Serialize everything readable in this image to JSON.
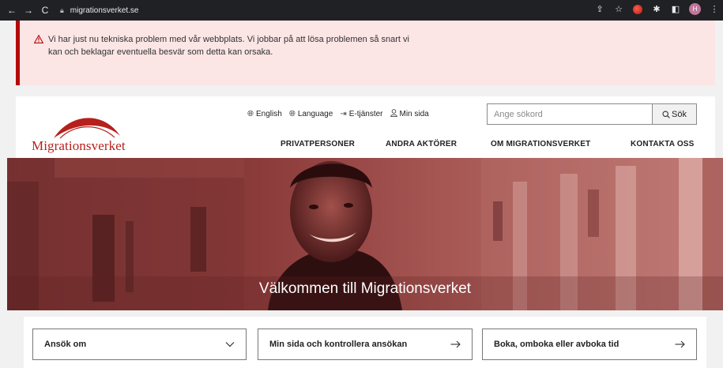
{
  "browser": {
    "url": "migrationsverket.se",
    "profile_initial": "H"
  },
  "alert": {
    "message": "Vi har just nu tekniska problem med vår webbplats. Vi jobbar på att lösa problemen så snart vi kan och beklagar eventuella besvär som detta kan orsaka."
  },
  "header": {
    "logo_text": "Migrationsverket",
    "util_links": [
      "English",
      "Language",
      "E-tjänster",
      "Min sida"
    ],
    "search_placeholder": "Ange sökord",
    "search_button": "Sök",
    "nav": [
      "PRIVATPERSONER",
      "ANDRA AKTÖRER",
      "OM MIGRATIONSVERKET",
      "KONTAKTA OSS"
    ]
  },
  "hero": {
    "title": "Välkommen till Migrationsverket"
  },
  "cards": [
    {
      "label": "Ansök om",
      "icon": "chevron-down-icon"
    },
    {
      "label": "Min sida och kontrollera ansökan",
      "icon": "arrow-right-icon"
    },
    {
      "label": "Boka, omboka eller avboka tid",
      "icon": "arrow-right-icon"
    }
  ],
  "colors": {
    "brand_red": "#b6201c",
    "alert_bg": "#fbe5e5",
    "alert_border": "#b40a0a"
  }
}
